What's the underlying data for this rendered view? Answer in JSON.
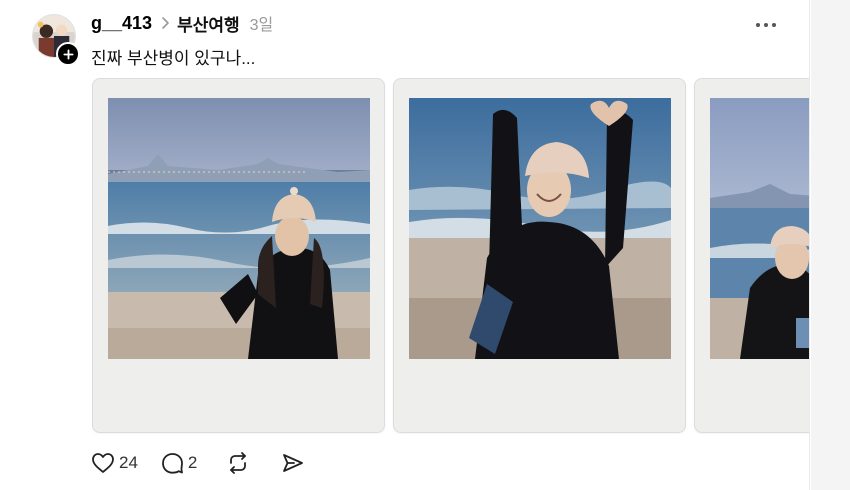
{
  "post": {
    "username": "g__413",
    "topic": "부산여행",
    "time": "3일",
    "text": "진짜 부산병이 있구나...",
    "photos": [
      {
        "name": "photo-1"
      },
      {
        "name": "photo-2"
      },
      {
        "name": "photo-3"
      }
    ]
  },
  "actions": {
    "likes": "24",
    "replies": "2"
  },
  "icons": [
    "heart-icon",
    "comment-icon",
    "repost-icon",
    "share-icon",
    "more-icon",
    "chevron-right-icon",
    "plus-icon"
  ]
}
